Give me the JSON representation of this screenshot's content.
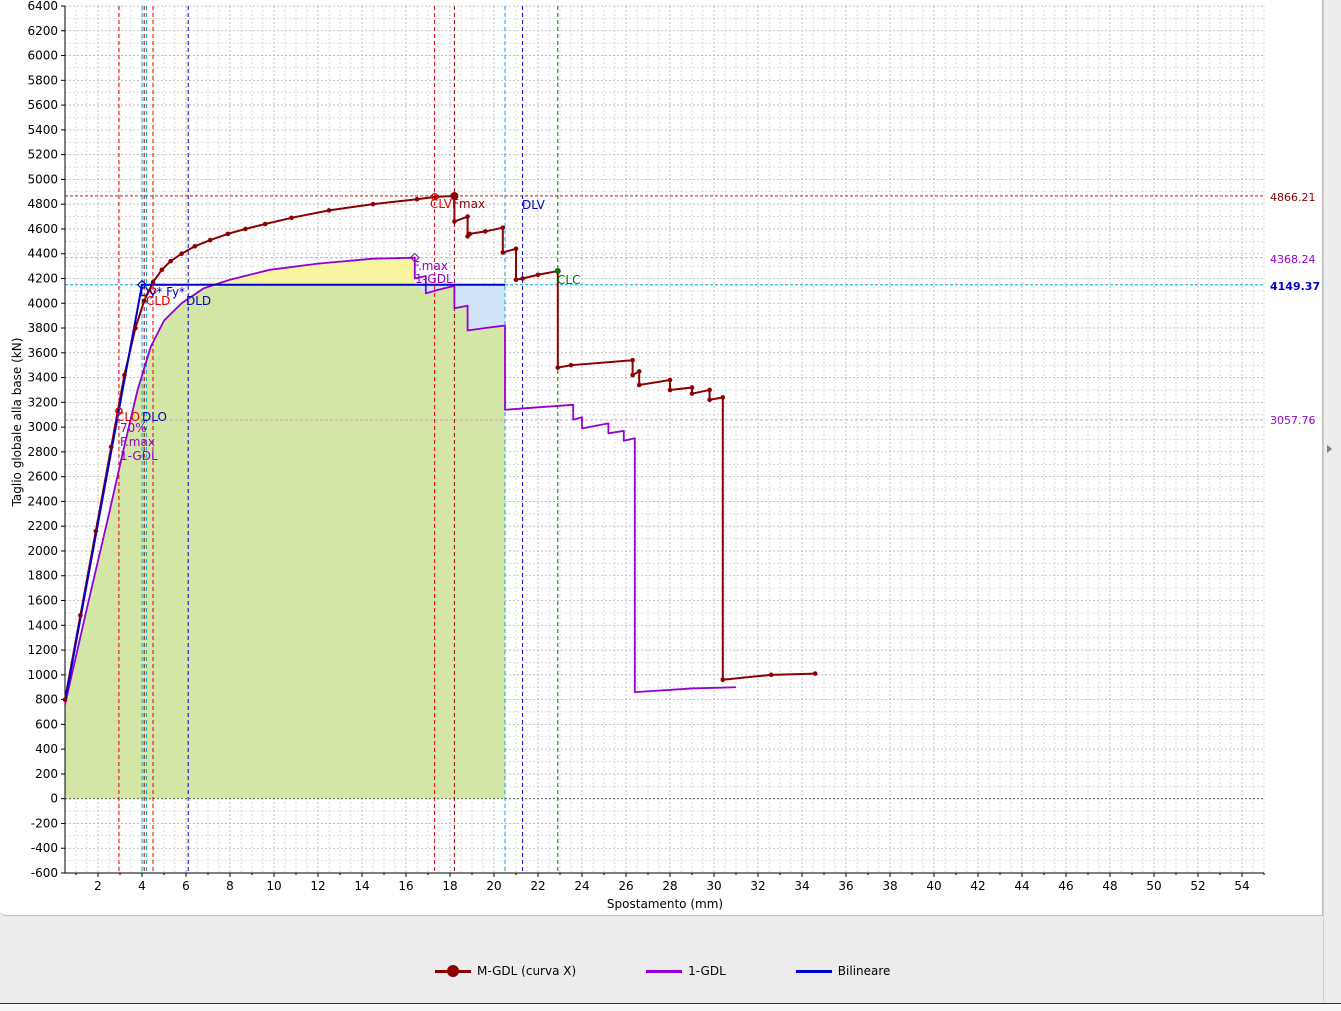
{
  "legend": {
    "mgdl_label": "M-GDL (curva X)",
    "gdl1_label": "1-GDL",
    "bilineare_label": "Bilineare"
  },
  "colors": {
    "mgdl": "#8b0000",
    "gdl1": "#9400d3",
    "bilineare": "#0000cd",
    "fill_green": "#d4e6a6",
    "fill_yellow": "#f7f5a0",
    "fill_blue": "#cfe4f7",
    "red_lines": "#e00000",
    "cyan_lines": "#00aadd",
    "blue_lines": "#0000dd",
    "green_line": "#007700",
    "darkred_line": "#a00000"
  },
  "chart_data": {
    "type": "line",
    "xlabel": "Spostamento (mm)",
    "ylabel": "Taglio globale alla base (kN)",
    "xlim": [
      0.5,
      55
    ],
    "ylim": [
      -600,
      6400
    ],
    "x_ticks": [
      2,
      4,
      6,
      8,
      10,
      12,
      14,
      16,
      18,
      20,
      22,
      24,
      26,
      28,
      30,
      32,
      34,
      36,
      38,
      40,
      42,
      44,
      46,
      48,
      50,
      52,
      54
    ],
    "y_ticks": [
      -600,
      -400,
      -200,
      0,
      200,
      400,
      600,
      800,
      1000,
      1200,
      1400,
      1600,
      1800,
      2000,
      2200,
      2400,
      2600,
      2800,
      3000,
      3200,
      3400,
      3600,
      3800,
      4000,
      4200,
      4400,
      4600,
      4800,
      5000,
      5200,
      5400,
      5600,
      5800,
      6000,
      6200,
      6400
    ],
    "grid": true,
    "legend_placement": "bottom-center",
    "series": [
      {
        "name": "M-GDL (curva X)",
        "points": [
          [
            0.5,
            800
          ],
          [
            1.2,
            1480
          ],
          [
            1.9,
            2160
          ],
          [
            2.6,
            2840
          ],
          [
            3.2,
            3420
          ],
          [
            3.7,
            3800
          ],
          [
            4.1,
            4020
          ],
          [
            4.5,
            4170
          ],
          [
            4.9,
            4270
          ],
          [
            5.3,
            4340
          ],
          [
            5.8,
            4400
          ],
          [
            6.4,
            4460
          ],
          [
            7.1,
            4510
          ],
          [
            7.9,
            4560
          ],
          [
            8.7,
            4600
          ],
          [
            9.6,
            4640
          ],
          [
            10.8,
            4690
          ],
          [
            12.5,
            4750
          ],
          [
            14.5,
            4800
          ],
          [
            16.5,
            4840
          ],
          [
            17.4,
            4860
          ],
          [
            18.2,
            4866
          ],
          [
            18.2,
            4660
          ],
          [
            18.8,
            4700
          ],
          [
            18.8,
            4540
          ],
          [
            18.9,
            4560
          ],
          [
            19.6,
            4580
          ],
          [
            20.4,
            4610
          ],
          [
            20.4,
            4410
          ],
          [
            21.0,
            4440
          ],
          [
            21.0,
            4190
          ],
          [
            21.3,
            4200
          ],
          [
            22.0,
            4230
          ],
          [
            22.9,
            4260
          ],
          [
            22.9,
            3480
          ],
          [
            23.5,
            3500
          ],
          [
            26.3,
            3540
          ],
          [
            26.3,
            3420
          ],
          [
            26.6,
            3450
          ],
          [
            26.6,
            3340
          ],
          [
            28.0,
            3380
          ],
          [
            28.0,
            3300
          ],
          [
            29.0,
            3320
          ],
          [
            29.0,
            3270
          ],
          [
            29.8,
            3300
          ],
          [
            29.8,
            3220
          ],
          [
            30.4,
            3240
          ],
          [
            30.4,
            960
          ],
          [
            32.6,
            1000
          ],
          [
            34.6,
            1010
          ]
        ]
      },
      {
        "name": "1-GDL",
        "points": [
          [
            0.5,
            760
          ],
          [
            1.5,
            1540
          ],
          [
            2.5,
            2300
          ],
          [
            3.2,
            2850
          ],
          [
            3.8,
            3300
          ],
          [
            4.4,
            3650
          ],
          [
            5.0,
            3860
          ],
          [
            5.8,
            4000
          ],
          [
            6.8,
            4120
          ],
          [
            8.0,
            4190
          ],
          [
            9.8,
            4270
          ],
          [
            12.0,
            4320
          ],
          [
            14.5,
            4360
          ],
          [
            16.4,
            4368
          ],
          [
            16.4,
            4200
          ],
          [
            16.9,
            4220
          ],
          [
            16.9,
            4080
          ],
          [
            17.5,
            4110
          ],
          [
            18.2,
            4140
          ],
          [
            18.2,
            3960
          ],
          [
            18.8,
            3980
          ],
          [
            18.8,
            3780
          ],
          [
            19.6,
            3800
          ],
          [
            20.5,
            3820
          ],
          [
            20.5,
            3140
          ],
          [
            22.0,
            3160
          ],
          [
            23.6,
            3180
          ],
          [
            23.6,
            3060
          ],
          [
            24.0,
            3080
          ],
          [
            24.0,
            2990
          ],
          [
            25.2,
            3030
          ],
          [
            25.2,
            2950
          ],
          [
            25.9,
            2970
          ],
          [
            25.9,
            2890
          ],
          [
            26.4,
            2910
          ],
          [
            26.4,
            860
          ],
          [
            29.0,
            890
          ],
          [
            31.0,
            900
          ]
        ]
      },
      {
        "name": "Bilineare",
        "points": [
          [
            0.5,
            780
          ],
          [
            4.0,
            4149.37
          ],
          [
            20.5,
            4149.37
          ]
        ]
      }
    ],
    "value_labels": [
      "4866.21",
      "4368.24",
      "4149.37",
      "3057.76"
    ],
    "annotations": [
      "CLV",
      "Fmax",
      "DLV",
      "F.max",
      "1-GDL",
      "CLC",
      "Dy* Fy*",
      "CLD",
      "DLD",
      "CLO",
      "DLO",
      "70%",
      "F.max",
      "1-GDL"
    ]
  }
}
